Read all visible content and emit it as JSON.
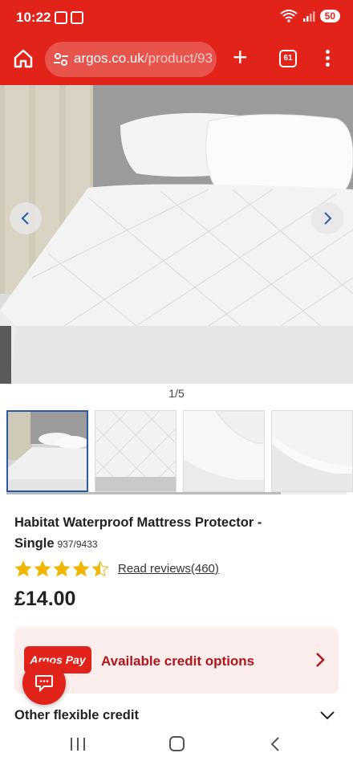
{
  "status_bar": {
    "time": "10:22",
    "battery": "50"
  },
  "browser": {
    "url_host": "argos.co.uk",
    "url_path": "/product/93",
    "tab_count": "61"
  },
  "gallery": {
    "counter": "1/5",
    "thumbnails": [
      "mattress-protector-bed",
      "quilted-closeup",
      "corner-elastic",
      "plain-side"
    ],
    "active_index": 0
  },
  "product": {
    "title": "Habitat Waterproof Mattress Protector - Single",
    "sku": "937/9433",
    "rating": 4.5,
    "reviews_label": "Read reviews",
    "reviews_count": "(460)",
    "price": "£14.00"
  },
  "credit": {
    "logo_text": "Argos Pay",
    "label": "Available credit options"
  },
  "other_credit": {
    "label": "Other flexible credit"
  },
  "colors": {
    "brand_red": "#e2231a",
    "star": "#f2b705",
    "credit_bg": "#fdeeee"
  }
}
